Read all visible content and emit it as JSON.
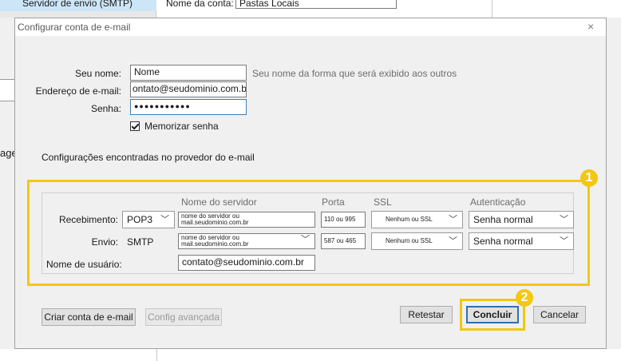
{
  "background": {
    "sidebar_item": "Servidor de envio (SMTP)",
    "account_name_label": "Nome da conta:",
    "account_name_value": "Pastas Locais",
    "left_fragment": "age"
  },
  "dialog": {
    "title": "Configurar conta de e-mail",
    "close_glyph": "×",
    "name_label": "Seu nome:",
    "name_value": "Nome",
    "name_hint": "Seu nome da forma que será exibido aos outros",
    "email_label": "Endereço de e-mail:",
    "email_value": "ontato@seudominio.com.br",
    "password_label": "Senha:",
    "password_value": "●●●●●●●●●●●",
    "remember_label": "Memorizar senha",
    "section_title": "Configurações encontradas no provedor do e-mail"
  },
  "server_settings": {
    "headers": {
      "server": "Nome do servidor",
      "port": "Porta",
      "ssl": "SSL",
      "auth": "Autenticação"
    },
    "incoming": {
      "label": "Recebimento:",
      "protocol": "POP3",
      "server_line1": "nome do servidor ou",
      "server_line2": "mail.seudominio.com.br",
      "port": "110 ou 995",
      "ssl": "Nenhum ou SSL",
      "auth": "Senha normal"
    },
    "outgoing": {
      "label": "Envio:",
      "protocol": "SMTP",
      "server_line1": "nome do servidor ou",
      "server_line2": "mail.seudominio.com.br",
      "port": "587 ou 465",
      "ssl": "Nenhum ou SSL",
      "auth": "Senha normal"
    },
    "username_label": "Nome de usuário:",
    "username_value": "contato@seudominio.com.br"
  },
  "buttons": {
    "create": "Criar conta de e-mail",
    "advanced": "Config avançada",
    "retest": "Retestar",
    "done": "Concluir",
    "cancel": "Cancelar"
  },
  "annotations": {
    "badge1": "1",
    "badge2": "2",
    "highlight_color": "#f2c811"
  }
}
